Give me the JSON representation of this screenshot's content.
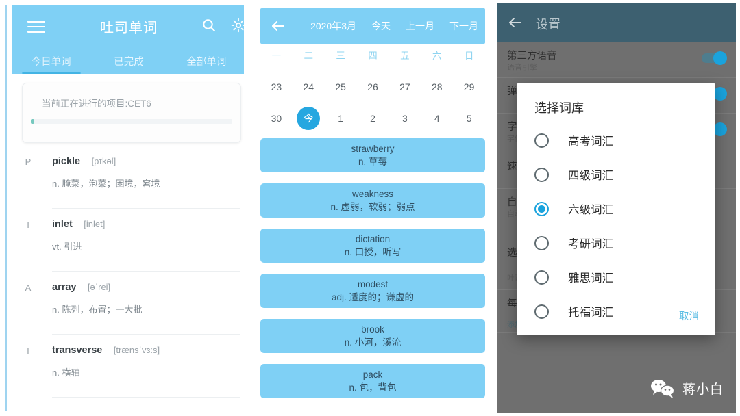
{
  "left_panel": {
    "appbar": {
      "menu_icon": "hamburger-icon",
      "title": "吐司单词",
      "search_icon": "search-icon",
      "settings_icon": "gear-icon"
    },
    "tabs": [
      {
        "label": "今日单词",
        "active": true
      },
      {
        "label": "已完成",
        "active": false
      },
      {
        "label": "全部单词",
        "active": false
      }
    ],
    "progress_card": {
      "text": "当前正在进行的项目:CET6",
      "progress_percent": 2
    },
    "words": [
      {
        "letter": "P",
        "word": "pickle",
        "ipa": "[pɪkəl]",
        "definition": "n. 腌菜，泡菜；困境，窘境"
      },
      {
        "letter": "I",
        "word": "inlet",
        "ipa": "[inlet]",
        "definition": "vt. 引进"
      },
      {
        "letter": "A",
        "word": "array",
        "ipa": "[əˈrei]",
        "definition": "n. 陈列，布置；一大批"
      },
      {
        "letter": "T",
        "word": "transverse",
        "ipa": "[trænsˈvɜːs]",
        "definition": "n. 横轴"
      }
    ]
  },
  "middle_panel": {
    "appbar": {
      "back_icon": "arrow-left-icon",
      "month_label": "2020年3月",
      "today_label": "今天",
      "prev_month_label": "上一月",
      "next_month_label": "下一月"
    },
    "weekdays": [
      "一",
      "二",
      "三",
      "四",
      "五",
      "六",
      "日"
    ],
    "date_rows": [
      [
        {
          "day": "23",
          "today": false
        },
        {
          "day": "24",
          "today": false
        },
        {
          "day": "25",
          "today": false
        },
        {
          "day": "26",
          "today": false
        },
        {
          "day": "27",
          "today": false
        },
        {
          "day": "28",
          "today": false
        },
        {
          "day": "29",
          "today": false
        }
      ],
      [
        {
          "day": "30",
          "today": false
        },
        {
          "day": "今",
          "today": true
        },
        {
          "day": "1",
          "today": false
        },
        {
          "day": "2",
          "today": false
        },
        {
          "day": "3",
          "today": false
        },
        {
          "day": "4",
          "today": false
        },
        {
          "day": "5",
          "today": false
        }
      ]
    ],
    "word_cards": [
      {
        "en": "strawberry",
        "cn": "n. 草莓"
      },
      {
        "en": "weakness",
        "cn": "n. 虚弱，软弱；弱点"
      },
      {
        "en": "dictation",
        "cn": "n. 口授，听写"
      },
      {
        "en": "modest",
        "cn": "adj. 适度的；谦虚的"
      },
      {
        "en": "brook",
        "cn": "n. 小河，溪流"
      },
      {
        "en": "pack",
        "cn": "n. 包，背包"
      }
    ]
  },
  "right_panel": {
    "appbar": {
      "back_icon": "arrow-left-icon",
      "title": "设置"
    },
    "settings_rows": [
      {
        "title": "第三方语音",
        "sub": "语音引擎",
        "toggle": false
      },
      {
        "title": "弹窗",
        "sub": "",
        "toggle": true
      },
      {
        "title": "字体",
        "sub": "字体大小",
        "toggle": true
      },
      {
        "title": "速度",
        "sub": "",
        "toggle": false
      },
      {
        "title": "自动播放",
        "sub": "自动播放单词",
        "toggle": false
      },
      {
        "title": "选择词库",
        "sub": "吐司词库",
        "toggle": false
      },
      {
        "title": "每个单词弹出次数",
        "sub": "添加",
        "toggle": false
      }
    ],
    "dialog": {
      "title": "选择词库",
      "options": [
        {
          "label": "高考词汇",
          "selected": false
        },
        {
          "label": "四级词汇",
          "selected": false
        },
        {
          "label": "六级词汇",
          "selected": true
        },
        {
          "label": "考研词汇",
          "selected": false
        },
        {
          "label": "雅思词汇",
          "selected": false
        },
        {
          "label": "托福词汇",
          "selected": false
        }
      ],
      "cancel_label": "取消"
    },
    "watermark": {
      "logo": "wechat-icon",
      "label": "蒋小白"
    }
  },
  "colors": {
    "primary_blue": "#7fd0f5",
    "accent_blue": "#1aa3dd",
    "appbar_dark": "#3d6070",
    "overlay_gray": "#6f6f6f",
    "progress_teal": "#76c9bf"
  }
}
